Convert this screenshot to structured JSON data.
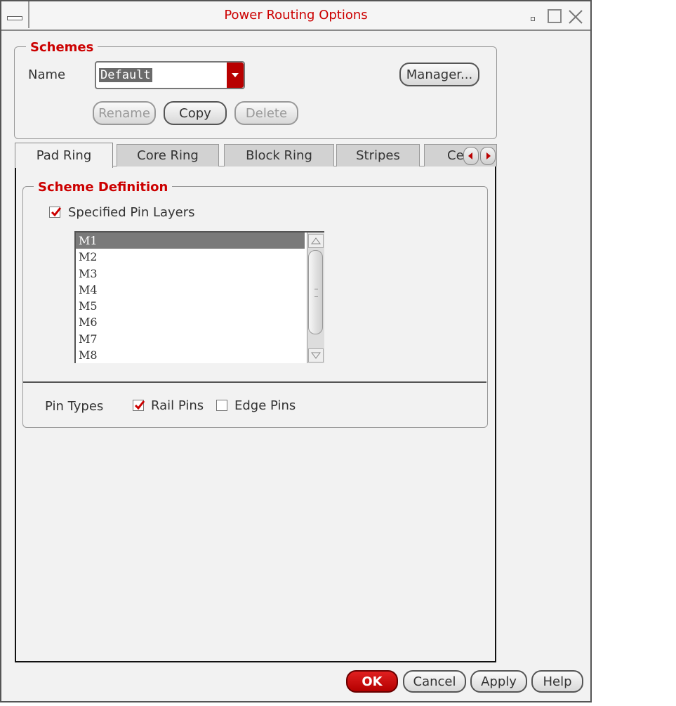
{
  "window": {
    "title": "Power Routing Options"
  },
  "schemes": {
    "group_label": "Schemes",
    "name_label": "Name",
    "name_value": "Default",
    "manager_label": "Manager...",
    "rename_label": "Rename",
    "copy_label": "Copy",
    "delete_label": "Delete"
  },
  "tabs": [
    {
      "label": "Pad Ring",
      "active": true
    },
    {
      "label": "Core Ring",
      "active": false
    },
    {
      "label": "Block Ring",
      "active": false
    },
    {
      "label": "Stripes",
      "active": false
    },
    {
      "label": "Ce",
      "active": false
    }
  ],
  "scheme_definition": {
    "group_label": "Scheme Definition",
    "specified_pin_layers_label": "Specified Pin Layers",
    "specified_pin_layers_checked": true,
    "layers": [
      "M1",
      "M2",
      "M3",
      "M4",
      "M5",
      "M6",
      "M7",
      "M8"
    ],
    "selected_layer": "M1",
    "pin_types_label": "Pin Types",
    "rail_pins_label": "Rail Pins",
    "rail_pins_checked": true,
    "edge_pins_label": "Edge Pins",
    "edge_pins_checked": false
  },
  "footer": {
    "ok_label": "OK",
    "cancel_label": "Cancel",
    "apply_label": "Apply",
    "help_label": "Help"
  },
  "colors": {
    "accent": "#cc0000",
    "background": "#f2f2f2"
  }
}
